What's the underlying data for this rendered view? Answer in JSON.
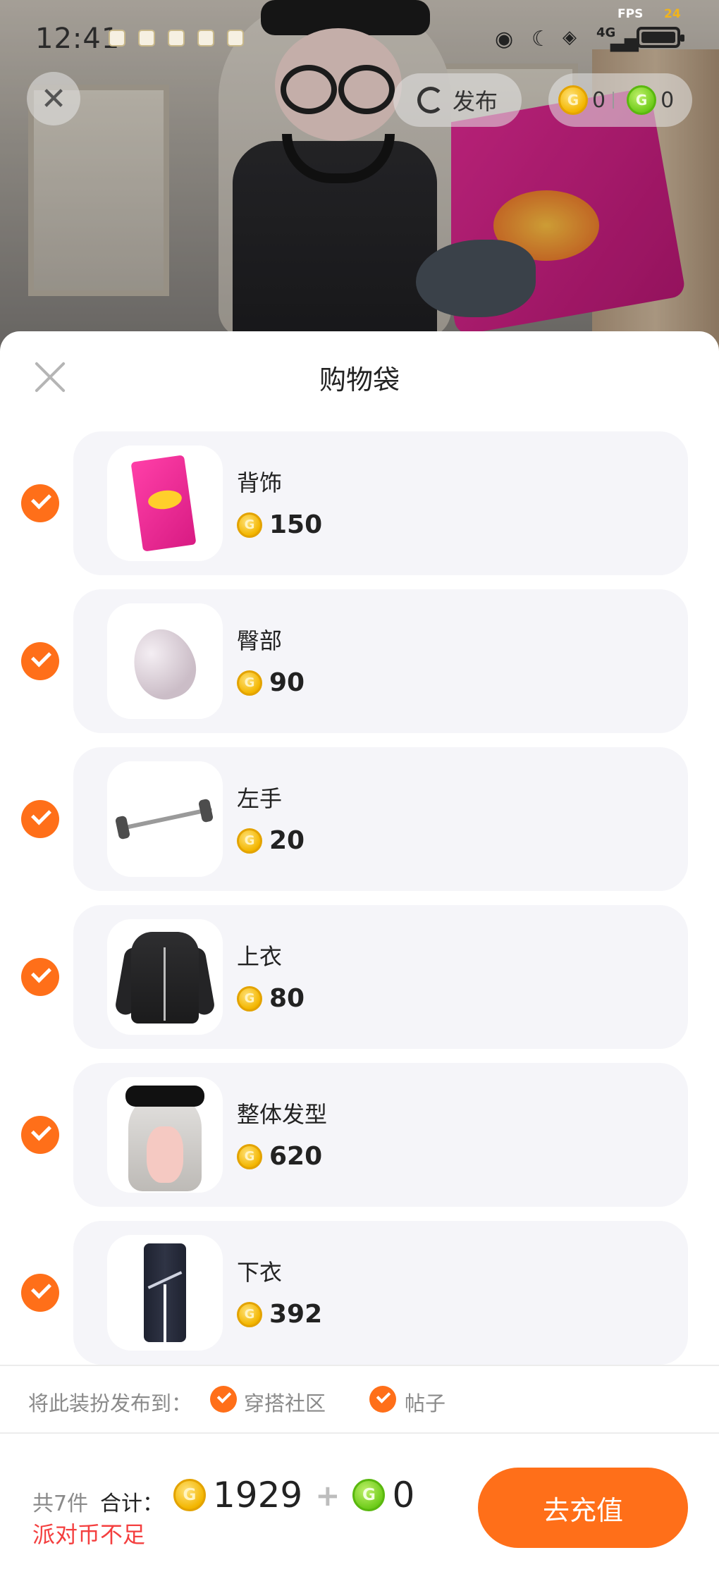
{
  "status_bar": {
    "time": "12:41",
    "fps_label": "FPS",
    "fps_value": "24",
    "network": "4G"
  },
  "top_bar": {
    "close_icon": "close-icon",
    "publish_label": "发布",
    "gold_coin_balance": "0",
    "green_coin_balance": "0"
  },
  "sheet": {
    "title": "购物袋",
    "items": [
      {
        "name": "背饰",
        "price": "150",
        "checked": true,
        "icon": "chips-bag-icon"
      },
      {
        "name": "臀部",
        "price": "90",
        "checked": true,
        "icon": "egg-shape-icon"
      },
      {
        "name": "左手",
        "price": "20",
        "checked": true,
        "icon": "barbell-icon"
      },
      {
        "name": "上衣",
        "price": "80",
        "checked": true,
        "icon": "hoodie-icon"
      },
      {
        "name": "整体发型",
        "price": "620",
        "checked": true,
        "icon": "hairstyle-icon"
      },
      {
        "name": "下衣",
        "price": "392",
        "checked": true,
        "icon": "pants-icon"
      }
    ]
  },
  "publish": {
    "label": "将此装扮发布到：",
    "options": [
      {
        "label": "穿搭社区",
        "checked": true
      },
      {
        "label": "帖子",
        "checked": true
      }
    ]
  },
  "footer": {
    "count": "共7件",
    "total_label": "合计：",
    "gold_total": "1929",
    "plus": "+",
    "green_total": "0",
    "warning": "派对币不足",
    "recharge_label": "去充值"
  },
  "colors": {
    "accent": "#ff6f19",
    "warning": "#f43f3f",
    "gold_coin": "#f3b600",
    "green_coin": "#6fcc1b",
    "card_bg": "#f5f5f9"
  }
}
